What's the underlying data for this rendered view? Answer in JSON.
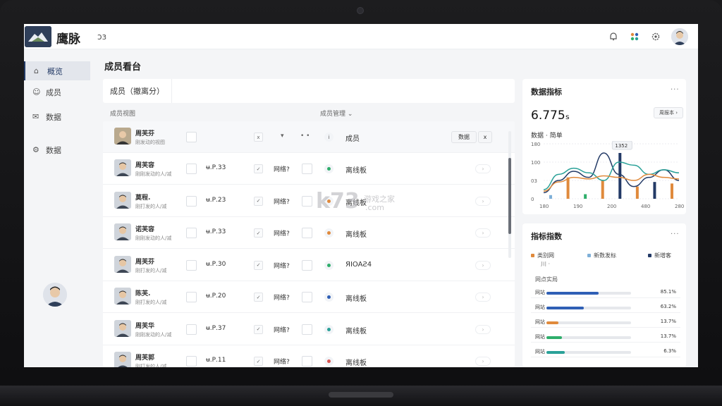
{
  "app": {
    "brand": "鹰脉",
    "brand_sub": "ɔɜ"
  },
  "sidebar": {
    "items": [
      {
        "label": "概览",
        "icon": "home-icon"
      },
      {
        "label": "成员",
        "icon": "user-icon"
      },
      {
        "label": "数据",
        "icon": "mail-icon"
      },
      {
        "label": "数据",
        "icon": "gear-icon"
      }
    ]
  },
  "main": {
    "title": "成员看台",
    "tab_label": "成员（撤离分）",
    "list_header_left": "成员视图",
    "list_header_mid": "成员管理 ⌄",
    "header_row": {
      "name": "周芙芬",
      "sub": "刚发动的视图",
      "check_icon": "x",
      "arrow": "▾",
      "dots": "• •",
      "role_label": "成员",
      "action_btn": "数据",
      "close_btn": "x"
    },
    "rows": [
      {
        "name": "周芙容",
        "sub": "刚刚发动的人/减",
        "value": "ʉ.Ρ.33",
        "tag": "网络?",
        "status": "离线板",
        "dot_color": "#2fae6b"
      },
      {
        "name": "莫程.",
        "sub": "刚打发的人/减",
        "value": "ʉ.Ρ.23",
        "tag": "网络?",
        "status": "离线板",
        "dot_color": "#e08a3c"
      },
      {
        "name": "诺芙容",
        "sub": "刚刚发动的人/减",
        "value": "ʉ.Ρ.33",
        "tag": "网络?",
        "status": "离线板",
        "dot_color": "#e08a3c"
      },
      {
        "name": "周芙芬",
        "sub": "刚打发的人/减",
        "value": "ʉ.Ρ.30",
        "tag": "网络?",
        "status": "ЯIOAƧ4",
        "dot_color": "#2fae6b"
      },
      {
        "name": "陈芙.",
        "sub": "刚打发的人/减",
        "value": "ʉ.Ρ.20",
        "tag": "网络?",
        "status": "离线板",
        "dot_color": "#2f5fb5"
      },
      {
        "name": "周芙华",
        "sub": "刚刚发动的人/减",
        "value": "ʉ.Ρ.37",
        "tag": "网络?",
        "status": "离线板",
        "dot_color": "#2aa198"
      },
      {
        "name": "周芙郭",
        "sub": "刚打发的人/减",
        "value": "ʉ.Ρ.11",
        "tag": "网络?",
        "status": "离线板",
        "dot_color": "#d9534f"
      }
    ]
  },
  "stats_panel": {
    "title": "数据指标",
    "more": "···",
    "big_number": "6.775ₛ",
    "range_btn": "周报本 ›",
    "chart_label": "数据 · 简单",
    "tooltip": "1352"
  },
  "breakdown_panel": {
    "title": "指标指数",
    "more": "···",
    "legend": [
      {
        "label": "类别网",
        "color": "#e08a3c"
      },
      {
        "label": "新数发标",
        "color": "#7fb0d8"
      },
      {
        "label": "新增客",
        "color": "#233a66"
      }
    ],
    "legend_sub": "川 ·",
    "list_title": "网点实局",
    "bars": [
      {
        "label": "网站",
        "value": "85.1%",
        "pct": 0.62,
        "color": "#2f5fb5"
      },
      {
        "label": "网站",
        "value": "63.2%",
        "pct": 0.44,
        "color": "#2f5fb5"
      },
      {
        "label": "网站",
        "value": "13.7%",
        "pct": 0.14,
        "color": "#e08a3c"
      },
      {
        "label": "网站",
        "value": "13.7%",
        "pct": 0.18,
        "color": "#2fae6b"
      },
      {
        "label": "网站",
        "value": "6.3%",
        "pct": 0.22,
        "color": "#2aa198"
      }
    ]
  },
  "chart_data": {
    "type": "line",
    "x": [
      "180",
      "190",
      "200",
      "480",
      "280"
    ],
    "ylim": [
      0,
      180
    ],
    "yticks": [
      "180",
      "100",
      "03",
      "0"
    ],
    "series": [
      {
        "color": "#233a66",
        "values": [
          20,
          60,
          90,
          70,
          150,
          80,
          40,
          70,
          95,
          60
        ]
      },
      {
        "color": "#2aa198",
        "values": [
          30,
          80,
          100,
          85,
          60,
          120,
          110,
          80,
          95,
          85
        ]
      },
      {
        "color": "#e08a3c",
        "values": [
          25,
          55,
          70,
          65,
          75,
          70,
          60,
          80,
          70,
          65
        ]
      }
    ],
    "bars": [
      {
        "value": 12,
        "color": "#7fb0d8"
      },
      {
        "value": 70,
        "color": "#e08a3c"
      },
      {
        "value": 15,
        "color": "#2fae6b"
      },
      {
        "value": 60,
        "color": "#e08a3c"
      },
      {
        "value": 150,
        "color": "#233a66"
      },
      {
        "value": 40,
        "color": "#e08a3c"
      },
      {
        "value": 55,
        "color": "#233a66"
      },
      {
        "value": 50,
        "color": "#e08a3c"
      }
    ]
  },
  "watermark": {
    "mark": "k73",
    "sub": "游戏之家",
    "domain": ".com"
  }
}
